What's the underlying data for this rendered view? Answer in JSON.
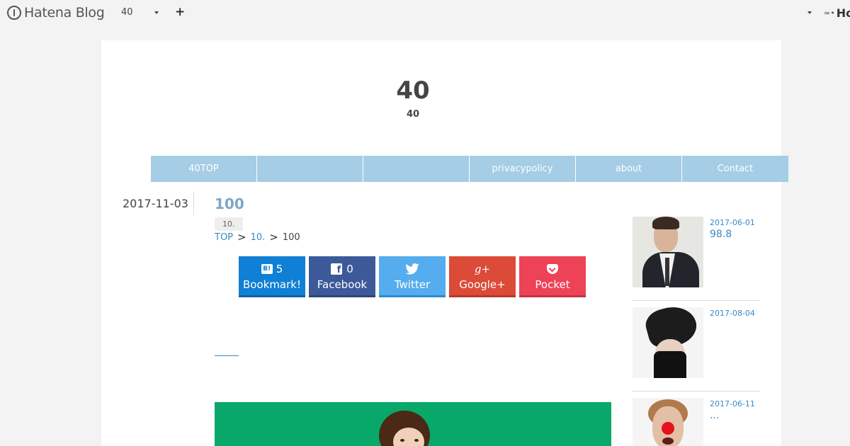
{
  "topbar": {
    "logo_text": "Hatena Blog",
    "blog_selector": "40",
    "add_label": "+",
    "right_logo_text": "Ho",
    "right_logo_mark": "≃•"
  },
  "header": {
    "title": "40",
    "subtitle": "40"
  },
  "nav": {
    "items": [
      {
        "label": "40TOP"
      },
      {
        "label": ""
      },
      {
        "label": ""
      },
      {
        "label": "privacypolicy"
      },
      {
        "label": "about"
      },
      {
        "label": "Contact"
      }
    ]
  },
  "entry": {
    "date": "2017-11-03",
    "title": "100",
    "category": "10.",
    "breadcrumb": {
      "top": "TOP",
      "sep": ">",
      "category": "10.",
      "current": "100"
    },
    "link_text": ""
  },
  "share": {
    "hatena": {
      "icon_text": "B!",
      "count": "5",
      "label": "Bookmark!"
    },
    "facebook": {
      "icon_text": "f",
      "count": "0",
      "label": "Facebook"
    },
    "twitter": {
      "label": "Twitter"
    },
    "google": {
      "icon_text": "g+",
      "label": "Google+"
    },
    "pocket": {
      "label": "Pocket"
    }
  },
  "sidebar": {
    "entries": [
      {
        "date": "2017-06-01",
        "title": "98.8"
      },
      {
        "date": "2017-08-04",
        "title": ""
      },
      {
        "date": "2017-06-11",
        "title": "..."
      }
    ]
  },
  "colors": {
    "nav": "#a5cde5",
    "link": "#3a8ac5",
    "hatena": "#0f80d5",
    "facebook": "#3c5a9a",
    "twitter": "#55acee",
    "google": "#dc4a38",
    "pocket": "#ee4256",
    "hero_bg": "#08a86a"
  }
}
